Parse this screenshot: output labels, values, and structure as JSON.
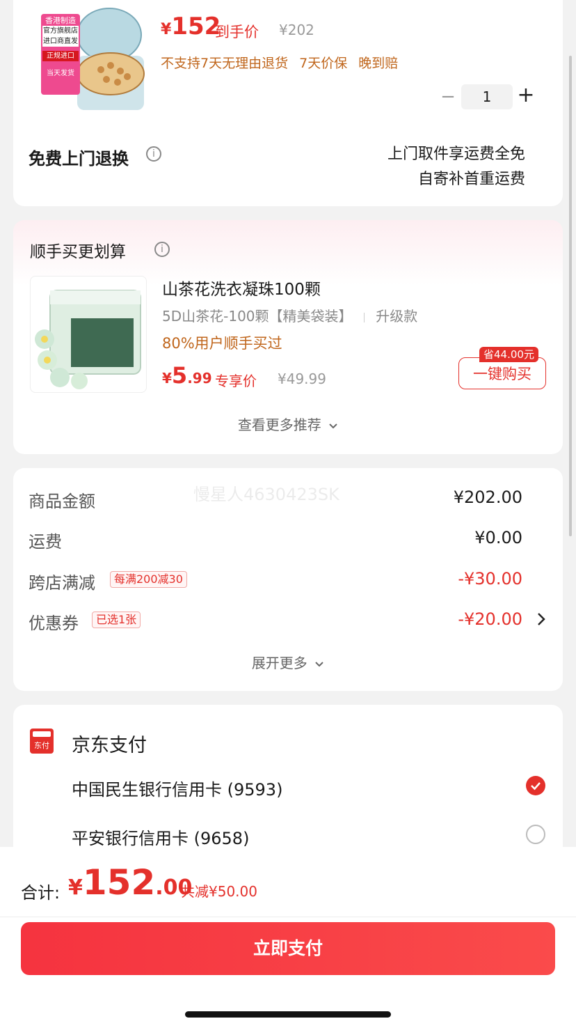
{
  "product": {
    "img_texts": [
      "香港制造",
      "官方旗舰店",
      "进口商直发",
      "正规进口",
      "当天发货"
    ],
    "price_symbol": "¥",
    "price": "152",
    "price_label": "到手价",
    "original_price": "¥202",
    "services": [
      "不支持7天无理由退货",
      "7天价保",
      "晚到赔"
    ],
    "quantity": "1",
    "return_title": "免费上门退换",
    "return_note_1": "上门取件享运费全免",
    "return_note_2": "自寄补首重运费"
  },
  "upsell": {
    "title": "顺手买更划算",
    "item_name": "山茶花洗衣凝珠100颗",
    "variant": "5D山茶花-100颗【精美袋装】",
    "variant_extra": "升级款",
    "social_proof": "80%用户顺手买过",
    "price_symbol": "¥",
    "price_int": "5",
    "price_dec": ".99",
    "price_label": "专享价",
    "original_price": "¥49.99",
    "save_badge": "省44.00元",
    "buy_button": "一键购买",
    "more": "查看更多推荐"
  },
  "summary": {
    "rows": [
      {
        "label": "商品金额",
        "value": "¥202.00"
      },
      {
        "label": "运费",
        "value": "¥0.00"
      },
      {
        "label": "跨店满减",
        "tag": "每满200减30",
        "value": "-¥30.00"
      },
      {
        "label": "优惠券",
        "tag": "已选1张",
        "value": "-¥20.00"
      }
    ],
    "expand": "展开更多",
    "watermark": "慢星人4630423SK"
  },
  "payment": {
    "title": "京东支付",
    "icon_text": "东付",
    "options": [
      {
        "label": "中国民生银行信用卡 (9593)",
        "selected": true
      },
      {
        "label": "平安银行信用卡 (9658)",
        "selected": false
      }
    ]
  },
  "bottom": {
    "total_label": "合计:",
    "total_symbol": "¥",
    "total_int": "152",
    "total_dec": ".00",
    "total_saved": "共减¥50.00",
    "pay_button": "立即支付"
  },
  "colors": {
    "accent": "#e4302b",
    "orange": "#c0661c",
    "background": "#f2f2f2"
  }
}
